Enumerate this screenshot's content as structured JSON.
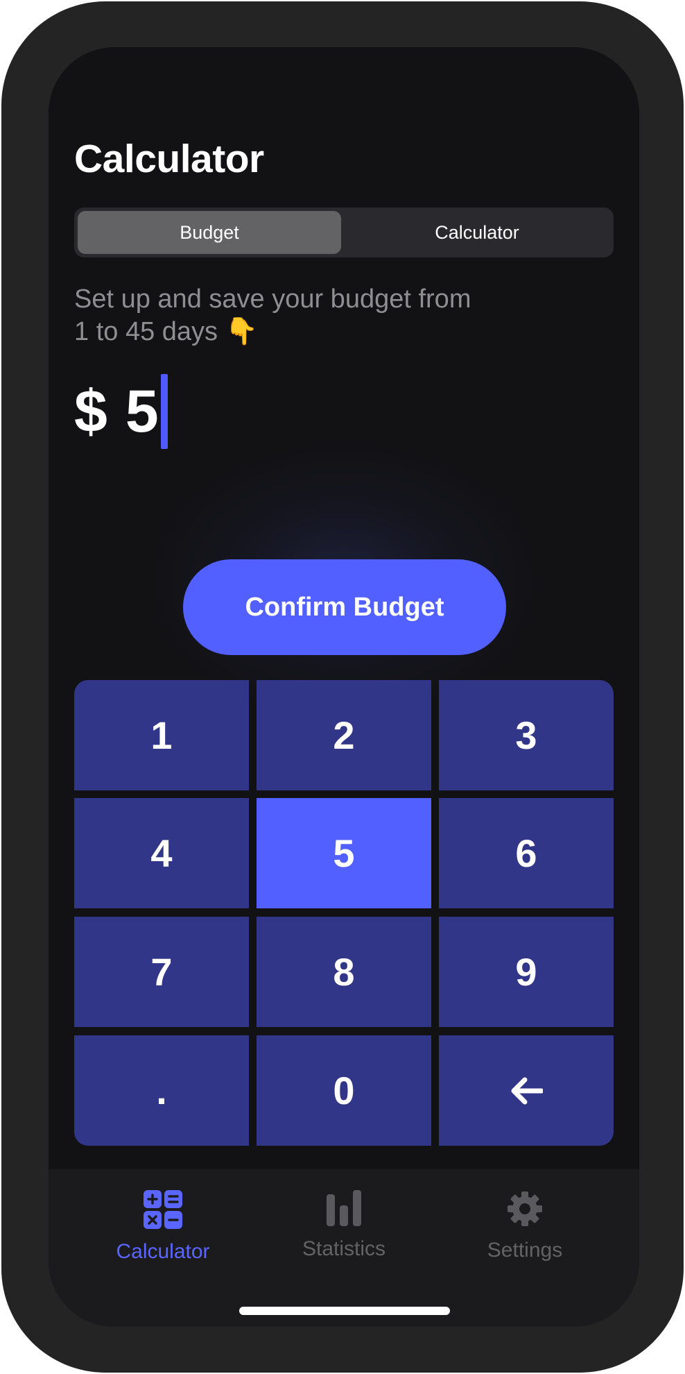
{
  "header": {
    "title": "Calculator"
  },
  "segmented": {
    "items": [
      "Budget",
      "Calculator"
    ],
    "selected": "Budget"
  },
  "intro": {
    "line1": "Set up and save your budget from",
    "line2": "1 to 45 days 👇"
  },
  "amount": {
    "currency": "$",
    "value": "5"
  },
  "confirm_label": "Confirm Budget",
  "keypad": {
    "keys": [
      "1",
      "2",
      "3",
      "4",
      "5",
      "6",
      "7",
      "8",
      "9",
      ".",
      "0",
      "←"
    ],
    "pressed": "5"
  },
  "tabbar": {
    "items": [
      {
        "label": "Calculator",
        "icon": "calculator-icon",
        "active": true
      },
      {
        "label": "Statistics",
        "icon": "bar-chart-icon",
        "active": false
      },
      {
        "label": "Settings",
        "icon": "gear-icon",
        "active": false
      }
    ]
  },
  "colors": {
    "accent": "#5260ff",
    "key_bg": "#323689",
    "background": "#121214",
    "tabbar": "#1b1b1d"
  }
}
